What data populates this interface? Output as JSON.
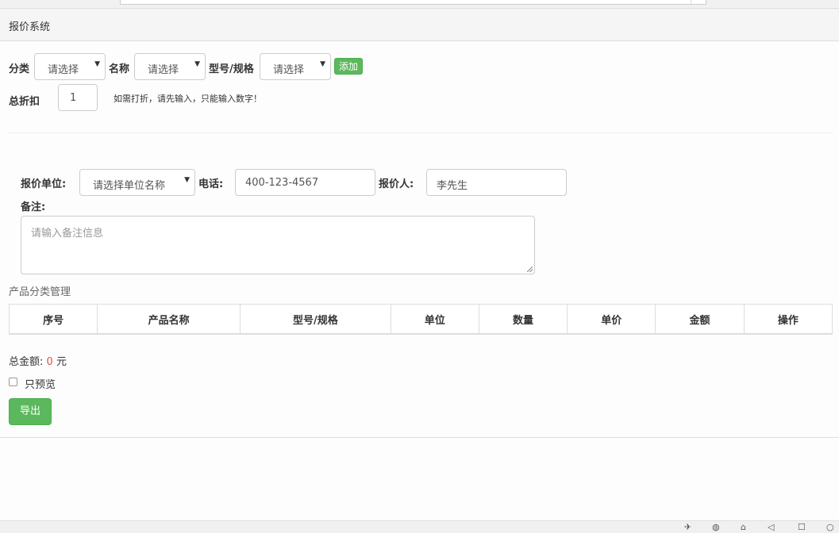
{
  "header": {
    "title": "报价系统"
  },
  "filters": {
    "category_label": "分类",
    "category_value": "请选择",
    "name_label": "名称",
    "name_value": "请选择",
    "model_label": "型号/规格",
    "model_value": "请选择",
    "add_label": "添加",
    "discount_label": "总折扣",
    "discount_value": "1",
    "discount_hint": "如需打折，请先输入，只能输入数字！"
  },
  "quote": {
    "unit_label": "报价单位:",
    "unit_value": "请选择单位名称",
    "phone_label": "电话:",
    "phone_value": "400-123-4567",
    "person_label": "报价人:",
    "person_value": "李先生",
    "remark_label": "备注:",
    "remark_placeholder": "请输入备注信息"
  },
  "products": {
    "section_title": "产品分类管理",
    "columns": [
      "序号",
      "产品名称",
      "型号/规格",
      "单位",
      "数量",
      "单价",
      "金额",
      "操作"
    ]
  },
  "summary": {
    "total_label": "总金额:",
    "total_value": "0",
    "total_unit": "元",
    "preview_label": "只预览",
    "preview_checked": false,
    "export_label": "导出"
  },
  "colors": {
    "primary_green": "#5cb85c",
    "amount_red": "#d9534f"
  },
  "statusbar_icons": [
    "pin-icon",
    "globe-icon",
    "trash-icon",
    "speaker-icon",
    "window-icon",
    "search-icon"
  ]
}
